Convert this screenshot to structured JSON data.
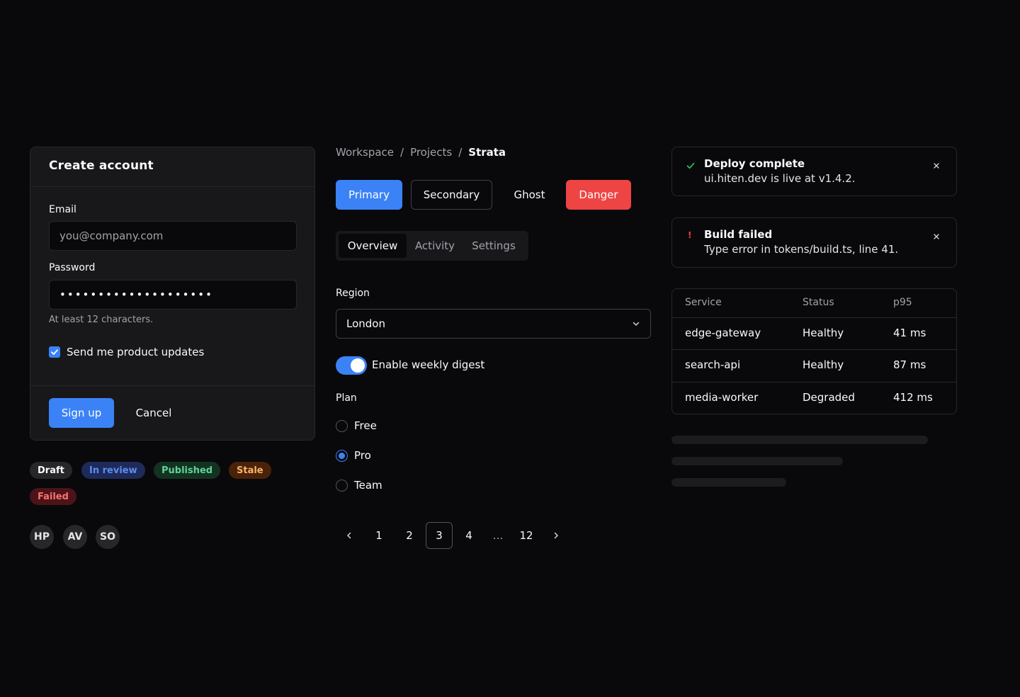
{
  "signup": {
    "title": "Create account",
    "email_label": "Email",
    "email_placeholder": "you@company.com",
    "password_label": "Password",
    "password_value": "••••••••••••••••••••",
    "password_hint": "At least 12 characters.",
    "updates_label": "Send me product updates",
    "submit_label": "Sign up",
    "cancel_label": "Cancel"
  },
  "badges": [
    {
      "label": "Draft",
      "bg": "#27272a",
      "fg": "#fafafa"
    },
    {
      "label": "In review",
      "bg": "#1e2a5a",
      "fg": "#5b8def"
    },
    {
      "label": "Published",
      "bg": "#143222",
      "fg": "#5ed394"
    },
    {
      "label": "Stale",
      "bg": "#4a2209",
      "fg": "#fbb26a"
    },
    {
      "label": "Failed",
      "bg": "#4c1418",
      "fg": "#f87171"
    }
  ],
  "avatars": [
    "HP",
    "AV",
    "SO"
  ],
  "breadcrumb": {
    "items": [
      "Workspace",
      "Projects"
    ],
    "current": "Strata",
    "separator": "/"
  },
  "buttons": {
    "primary": "Primary",
    "secondary": "Secondary",
    "ghost": "Ghost",
    "danger": "Danger"
  },
  "tabs": [
    "Overview",
    "Activity",
    "Settings"
  ],
  "region": {
    "label": "Region",
    "value": "London"
  },
  "digest": {
    "label": "Enable weekly digest",
    "enabled": true
  },
  "plan": {
    "label": "Plan",
    "options": [
      "Free",
      "Pro",
      "Team"
    ],
    "selected": "Pro"
  },
  "pagination": {
    "pages": [
      "1",
      "2",
      "3",
      "4"
    ],
    "ellipsis": "…",
    "last": "12",
    "current": "3"
  },
  "toasts": [
    {
      "title": "Deploy complete",
      "desc": "ui.hiten.dev is live at v1.4.2.",
      "icon": "check-icon",
      "color": "#22c55e"
    },
    {
      "title": "Build failed",
      "desc": "Type error in tokens/build.ts, line 41.",
      "icon": "alert-icon",
      "color": "#ef4444",
      "glyph": "!"
    }
  ],
  "services": {
    "headers": [
      "Service",
      "Status",
      "p95"
    ],
    "rows": [
      [
        "edge-gateway",
        "Healthy",
        "41 ms"
      ],
      [
        "search-api",
        "Healthy",
        "87 ms"
      ],
      [
        "media-worker",
        "Degraded",
        "412 ms"
      ]
    ]
  },
  "colors": {
    "accent": "#3b82f6",
    "danger": "#ef4444",
    "success": "#22c55e"
  }
}
